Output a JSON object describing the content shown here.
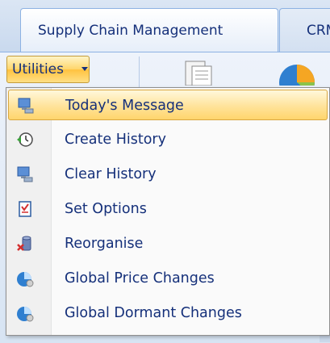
{
  "tabs": [
    {
      "label": "Supply Chain Management",
      "active": true
    },
    {
      "label": "CRM",
      "active": false
    }
  ],
  "toolbar": {
    "utilities_label": "Utilities"
  },
  "menu": {
    "items": [
      {
        "label": "Today's Message",
        "icon": "computer-message-icon",
        "highlighted": true
      },
      {
        "label": "Create History",
        "icon": "history-clock-icon"
      },
      {
        "label": "Clear History",
        "icon": "computer-clear-icon"
      },
      {
        "label": "Set Options",
        "icon": "checklist-icon"
      },
      {
        "label": "Reorganise",
        "icon": "database-repair-icon"
      },
      {
        "label": "Global Price Changes",
        "icon": "globe-pie-icon"
      },
      {
        "label": "Global Dormant Changes",
        "icon": "globe-pie-icon"
      }
    ]
  },
  "colors": {
    "highlight": "#ffd56c",
    "text": "#15307a",
    "tab_border": "#8db2e3"
  }
}
